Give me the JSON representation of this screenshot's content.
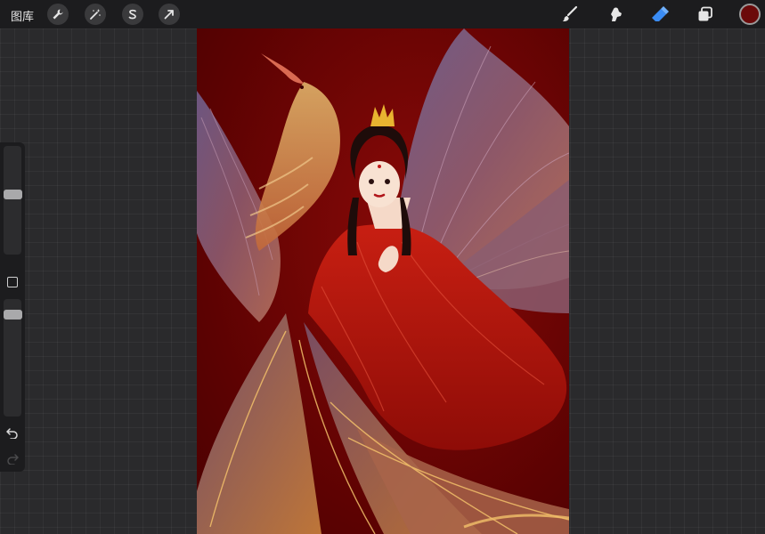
{
  "toolbar": {
    "gallery_label": "图库",
    "left_tools": [
      {
        "name": "actions-icon"
      },
      {
        "name": "adjustments-icon"
      },
      {
        "name": "selection-icon"
      },
      {
        "name": "transform-icon"
      }
    ],
    "right_tools": [
      {
        "name": "brush-icon"
      },
      {
        "name": "smudge-icon"
      },
      {
        "name": "eraser-icon",
        "active": true
      },
      {
        "name": "layers-icon"
      }
    ],
    "current_color": "#6b0a0a",
    "accent_color": "#3a8cf5"
  },
  "sidebar": {
    "brush_size_level": 0.56,
    "opacity_level": 0.1,
    "controls": [
      "modify-button",
      "undo-icon",
      "redo-icon"
    ]
  },
  "canvas": {
    "background_color": "#6a0303"
  }
}
